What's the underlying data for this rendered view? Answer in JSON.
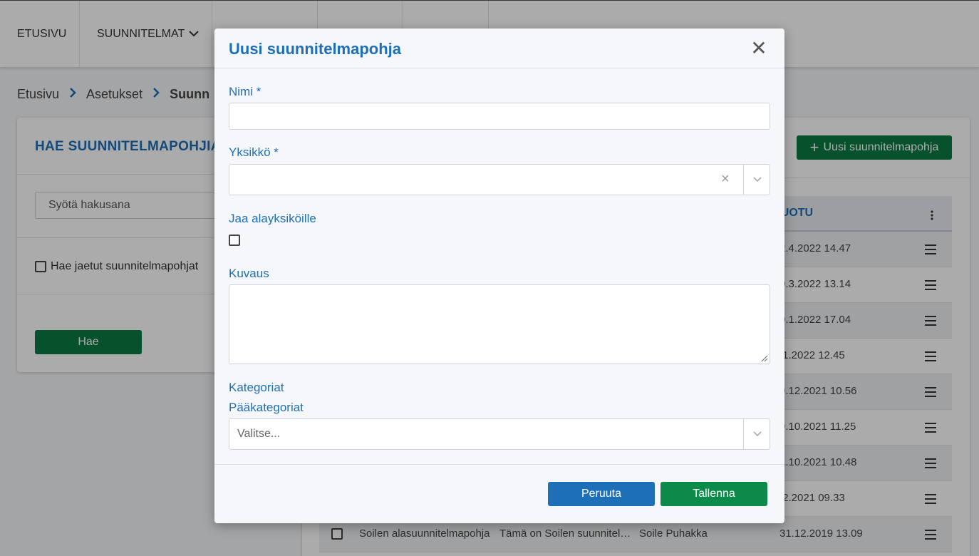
{
  "topnav": {
    "home": "ETUSIVU",
    "plans": "SUUNNITELMAT"
  },
  "breadcrumb": {
    "items": [
      "Etusivu",
      "Asetukset",
      "Suunn"
    ]
  },
  "search_panel": {
    "title": "HAE SUUNNITELMAPOHJIA",
    "input_placeholder": "Syötä hakusana",
    "shared_checkbox_label": "Hae jaetut suunnitelmapohjat",
    "search_button": "Hae"
  },
  "list_panel": {
    "new_button": "Uusi suunnitelmapohja",
    "column_created": "LUOTU",
    "rows": [
      {
        "name": "",
        "description": "",
        "owner": "",
        "created": "2.4.2022 14.47"
      },
      {
        "name": "",
        "description": "",
        "owner": "",
        "created": "0.3.2022 13.14"
      },
      {
        "name": "",
        "description": "",
        "owner": "",
        "created": "0.1.2022 17.04"
      },
      {
        "name": "",
        "description": "",
        "owner": "",
        "created": ".1.2022 12.45"
      },
      {
        "name": "",
        "description": "",
        "owner": "",
        "created": "9.12.2021 10.56"
      },
      {
        "name": "",
        "description": "",
        "owner": "",
        "created": "9.10.2021 11.25"
      },
      {
        "name": "",
        "description": "",
        "owner": "",
        "created": "1.10.2021 10.48"
      },
      {
        "name": "",
        "description": "",
        "owner": "",
        "created": ".2.2021 09.33"
      },
      {
        "name": "Soilen alasuunnitelmapohja",
        "description": "Tämä on Soilen suunnitel…",
        "owner": "Soile Puhakka",
        "created": "31.12.2019 13.09"
      }
    ]
  },
  "modal": {
    "title": "Uusi suunnitelmapohja",
    "close_glyph": "✕",
    "name_label": "Nimi *",
    "name_value": "",
    "unit_label": "Yksikkö *",
    "unit_value": "",
    "share_label": "Jaa alayksiköille",
    "share_checked": false,
    "description_label": "Kuvaus",
    "description_value": "",
    "categories_label": "Kategoriat",
    "main_categories_label": "Pääkategoriat",
    "main_categories_placeholder": "Valitse...",
    "cancel_button": "Peruuta",
    "save_button": "Tallenna"
  },
  "colors": {
    "primary_blue": "#1d6fb8",
    "primary_green": "#0b7a44",
    "save_green": "#0b8a4a"
  }
}
